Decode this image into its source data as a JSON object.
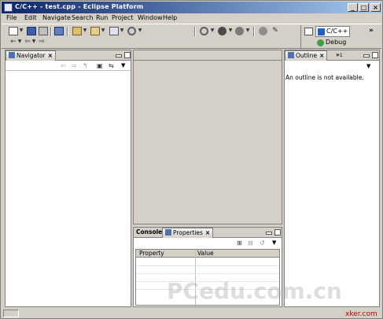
{
  "window": {
    "title": "C/C++ - test.cpp - Eclipse Platform",
    "controls": {
      "minimize": "_",
      "maximize": "□",
      "close": "×"
    }
  },
  "menubar": [
    "File",
    "Edit",
    "Navigate",
    "Search",
    "Run",
    "Project",
    "Window",
    "Help"
  ],
  "toolbar": {
    "icons": [
      "new-icon",
      "save-icon",
      "print-icon",
      "save-all-icon",
      "cpp-project-icon",
      "folder-icon",
      "build-icon",
      "refresh-icon",
      "debug-icon",
      "run-icon",
      "external-tools-icon",
      "search-icon",
      "open-type-icon",
      "back-icon",
      "forward-icon"
    ]
  },
  "perspectives": {
    "current": "C/C++",
    "other": "Debug",
    "more": "»"
  },
  "navigator": {
    "tab_label": "Navigator",
    "close": "×",
    "toolbar_icons": [
      "back-icon",
      "forward-icon",
      "up-icon",
      "collapse-all-icon",
      "link-editor-icon",
      "view-menu-icon"
    ]
  },
  "outline": {
    "tab_label": "Outline",
    "close": "×",
    "overflow_label": "»",
    "overflow_count": "1",
    "message": "An outline is not available."
  },
  "bottom": {
    "tabs": [
      "Console",
      "Properties"
    ],
    "active_tab": "Properties",
    "close": "×",
    "columns": [
      "Property",
      "Value"
    ]
  },
  "watermark": "PCedu.com.cn",
  "siteby": "xker.com"
}
